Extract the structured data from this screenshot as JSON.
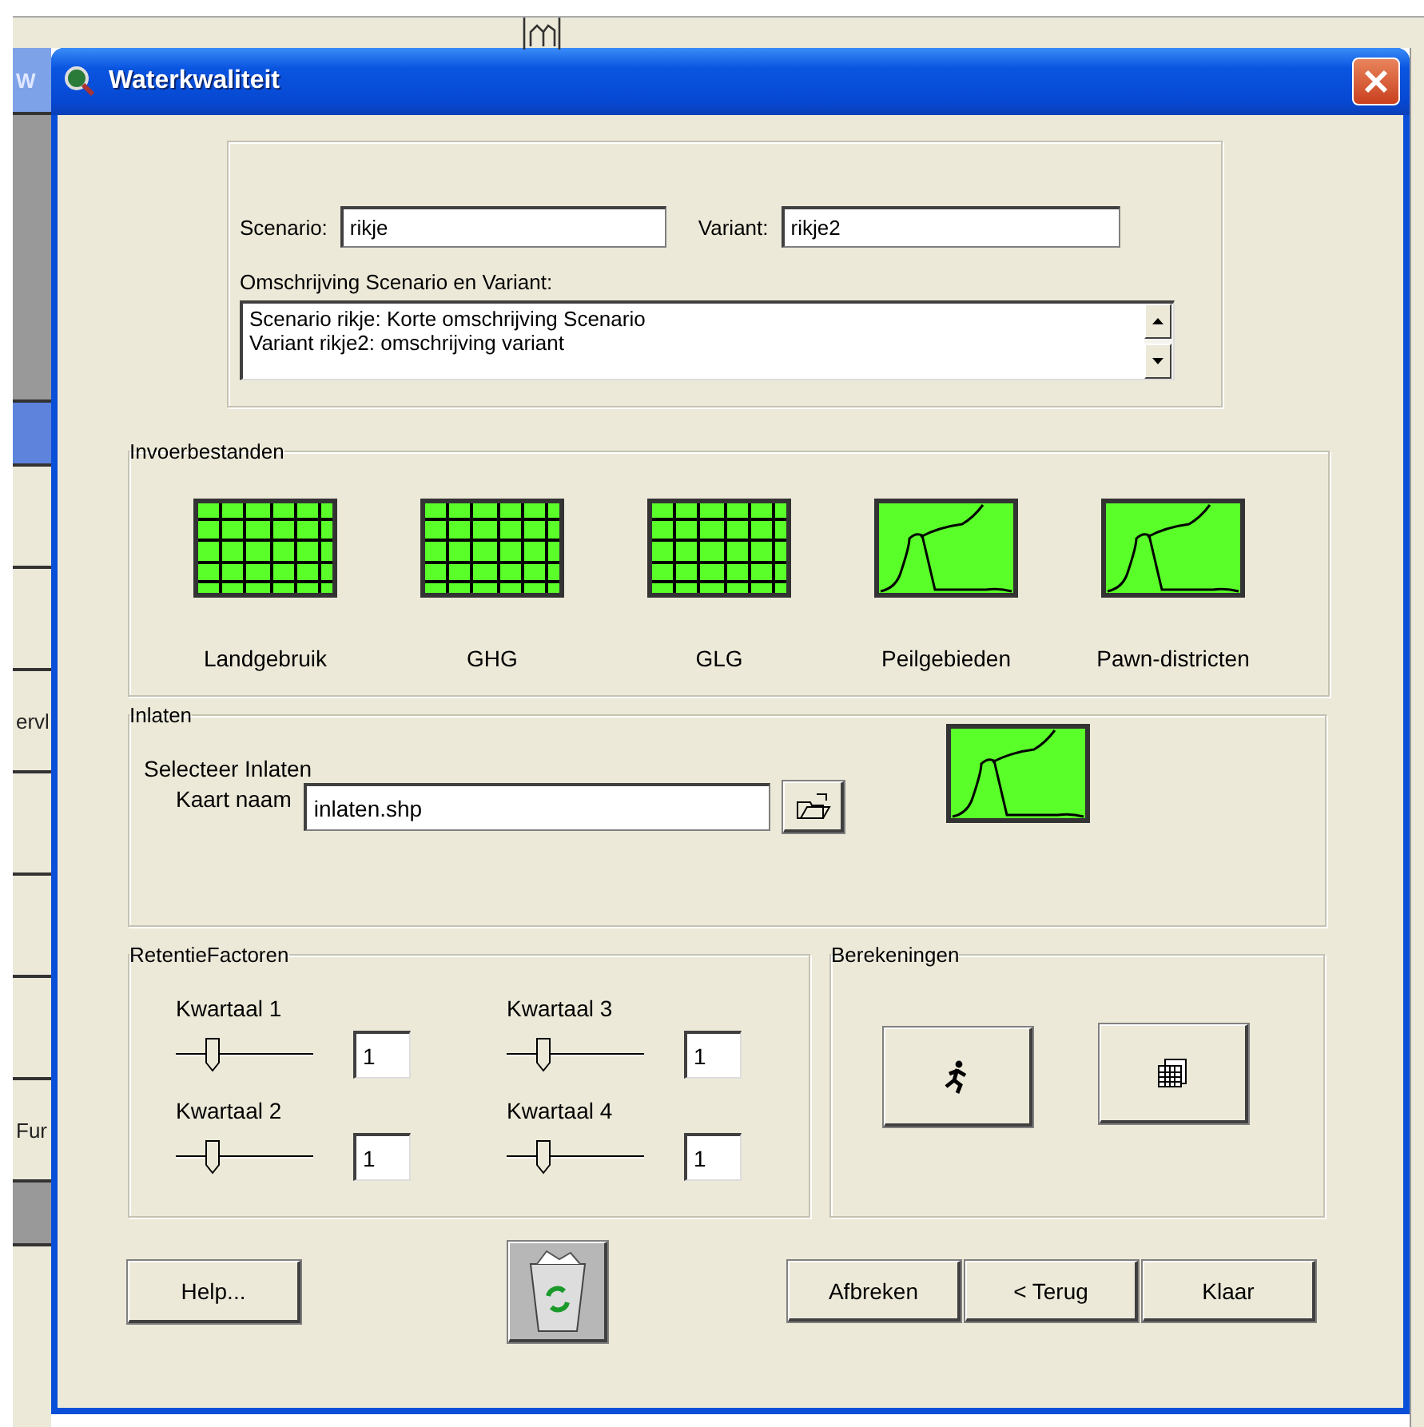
{
  "background": {
    "fragments": [
      "W",
      "ervl",
      "Fur"
    ]
  },
  "window": {
    "title": "Waterkwaliteit"
  },
  "scenario": {
    "scenario_label": "Scenario:",
    "scenario_value": "rikje",
    "variant_label": "Variant:",
    "variant_value": "rikje2",
    "description_label": "Omschrijving Scenario en Variant:",
    "description_lines": [
      "Scenario rikje: Korte omschrijving Scenario",
      "Variant rikje2: omschrijving variant"
    ]
  },
  "input_files": {
    "title": "Invoerbestanden",
    "items": [
      {
        "kind": "grid",
        "label": "Landgebruik"
      },
      {
        "kind": "grid",
        "label": "GHG"
      },
      {
        "kind": "grid",
        "label": "GLG"
      },
      {
        "kind": "graph",
        "label": "Peilgebieden"
      },
      {
        "kind": "graph",
        "label": "Pawn-districten"
      }
    ]
  },
  "inlets": {
    "title": "Inlaten",
    "subtitle": "Selecteer Inlaten",
    "map_label": "Kaart naam",
    "map_value": "inlaten.shp"
  },
  "retention": {
    "title": "RetentieFactoren",
    "quarters": [
      {
        "label": "Kwartaal 1",
        "level": 0.27,
        "value": "1"
      },
      {
        "label": "Kwartaal 3",
        "level": 0.27,
        "value": "1"
      },
      {
        "label": "Kwartaal 2",
        "level": 0.27,
        "value": "1"
      },
      {
        "label": "Kwartaal 4",
        "level": 0.27,
        "value": "1"
      }
    ]
  },
  "calculations": {
    "title": "Berekeningen"
  },
  "buttons": {
    "help": "Help...",
    "actions": [
      "Afbreken",
      "< Terug",
      "Klaar"
    ]
  }
}
